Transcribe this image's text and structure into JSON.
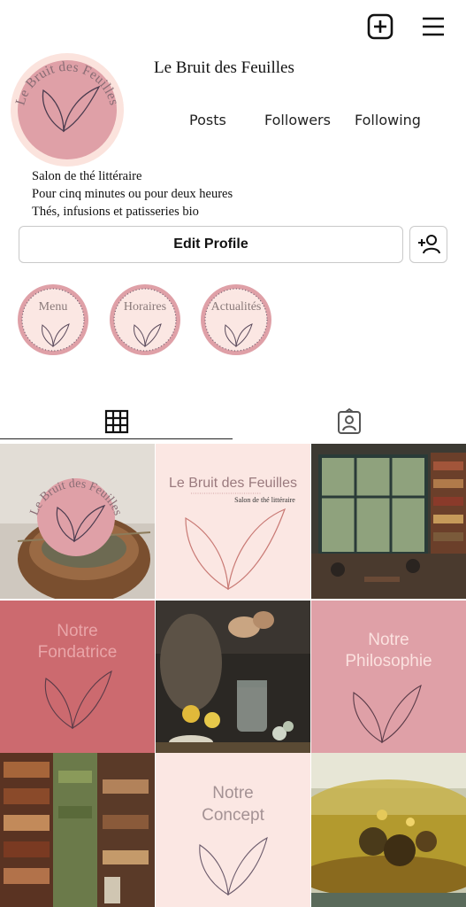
{
  "profile": {
    "username": "Le Bruit des Feuilles",
    "avatar_text": "Le Bruit des Feuilles",
    "stats": {
      "posts": "Posts",
      "followers": "Followers",
      "following": "Following"
    },
    "bio": [
      "Salon de thé littéraire",
      "Pour cinq minutes ou pour deux heures",
      "Thés, infusions et patisseries bio"
    ],
    "edit_label": "Edit Profile"
  },
  "highlights": [
    {
      "label": "Menu"
    },
    {
      "label": "Horaires"
    },
    {
      "label": "Actualités"
    }
  ],
  "tabs": [
    {
      "icon": "grid-icon"
    },
    {
      "icon": "tagged-icon"
    }
  ],
  "posts": [
    {
      "kind": "photo",
      "description_icon": "tea-pot-with-logo-photo"
    },
    {
      "kind": "graphic",
      "title": "Le Bruit des Feuilles",
      "subtitle": "Salon de thé littéraire"
    },
    {
      "kind": "photo",
      "description_icon": "library-cafe-photo"
    },
    {
      "kind": "graphic",
      "line1": "Notre",
      "line2": "Fondatrice"
    },
    {
      "kind": "photo",
      "description_icon": "herbs-jar-photo"
    },
    {
      "kind": "graphic",
      "line1": "Notre",
      "line2": "Philosophie"
    },
    {
      "kind": "photo",
      "description_icon": "bookshelves-photo"
    },
    {
      "kind": "graphic",
      "line1": "Notre",
      "line2": "Concept"
    },
    {
      "kind": "photo",
      "description_icon": "tea-cup-photo"
    }
  ],
  "colors": {
    "accent_rose": "#dfa0a7",
    "blush": "#fbe7e3",
    "deep_rose": "#cc6a6f",
    "line": "#6b5a6b"
  }
}
